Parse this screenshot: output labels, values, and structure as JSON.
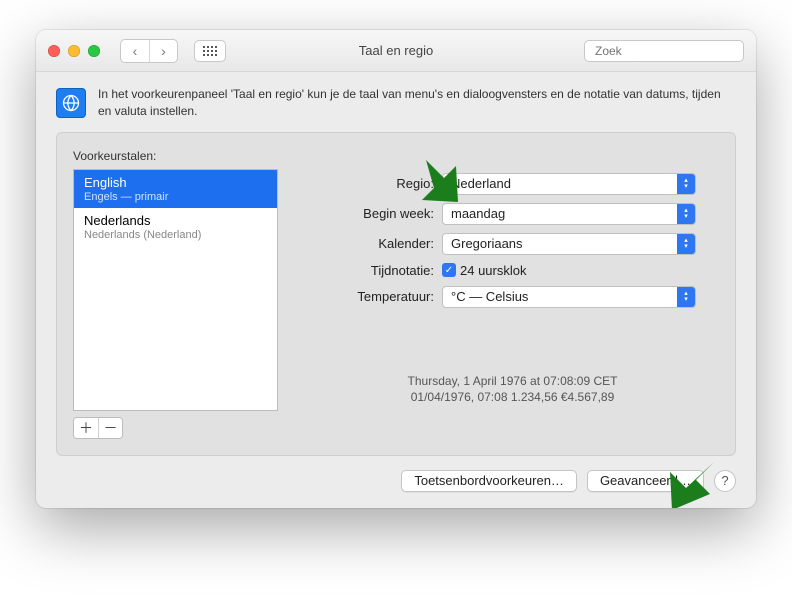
{
  "header": {
    "title": "Taal en regio",
    "search_placeholder": "Zoek"
  },
  "intro": "In het voorkeurenpaneel 'Taal en regio' kun je de taal van menu's en dialoogvensters en de notatie van datums, tijden en valuta instellen.",
  "languages": {
    "label": "Voorkeurstalen:",
    "items": [
      {
        "name": "English",
        "sub": "Engels — primair",
        "selected": true
      },
      {
        "name": "Nederlands",
        "sub": "Nederlands (Nederland)",
        "selected": false
      }
    ]
  },
  "form": {
    "region_label": "Regio:",
    "region_value": "Nederland",
    "week_label": "Begin week:",
    "week_value": "maandag",
    "calendar_label": "Kalender:",
    "calendar_value": "Gregoriaans",
    "time_label": "Tijdnotatie:",
    "time_checkbox": "24 uursklok",
    "temp_label": "Temperatuur:",
    "temp_value": "°C — Celsius"
  },
  "preview": {
    "line1": "Thursday, 1 April 1976 at 07:08:09 CET",
    "line2": "01/04/1976, 07:08    1.234,56    €4.567,89"
  },
  "buttons": {
    "keyboard": "Toetsenbordvoorkeuren…",
    "advanced": "Geavanceerd…"
  }
}
